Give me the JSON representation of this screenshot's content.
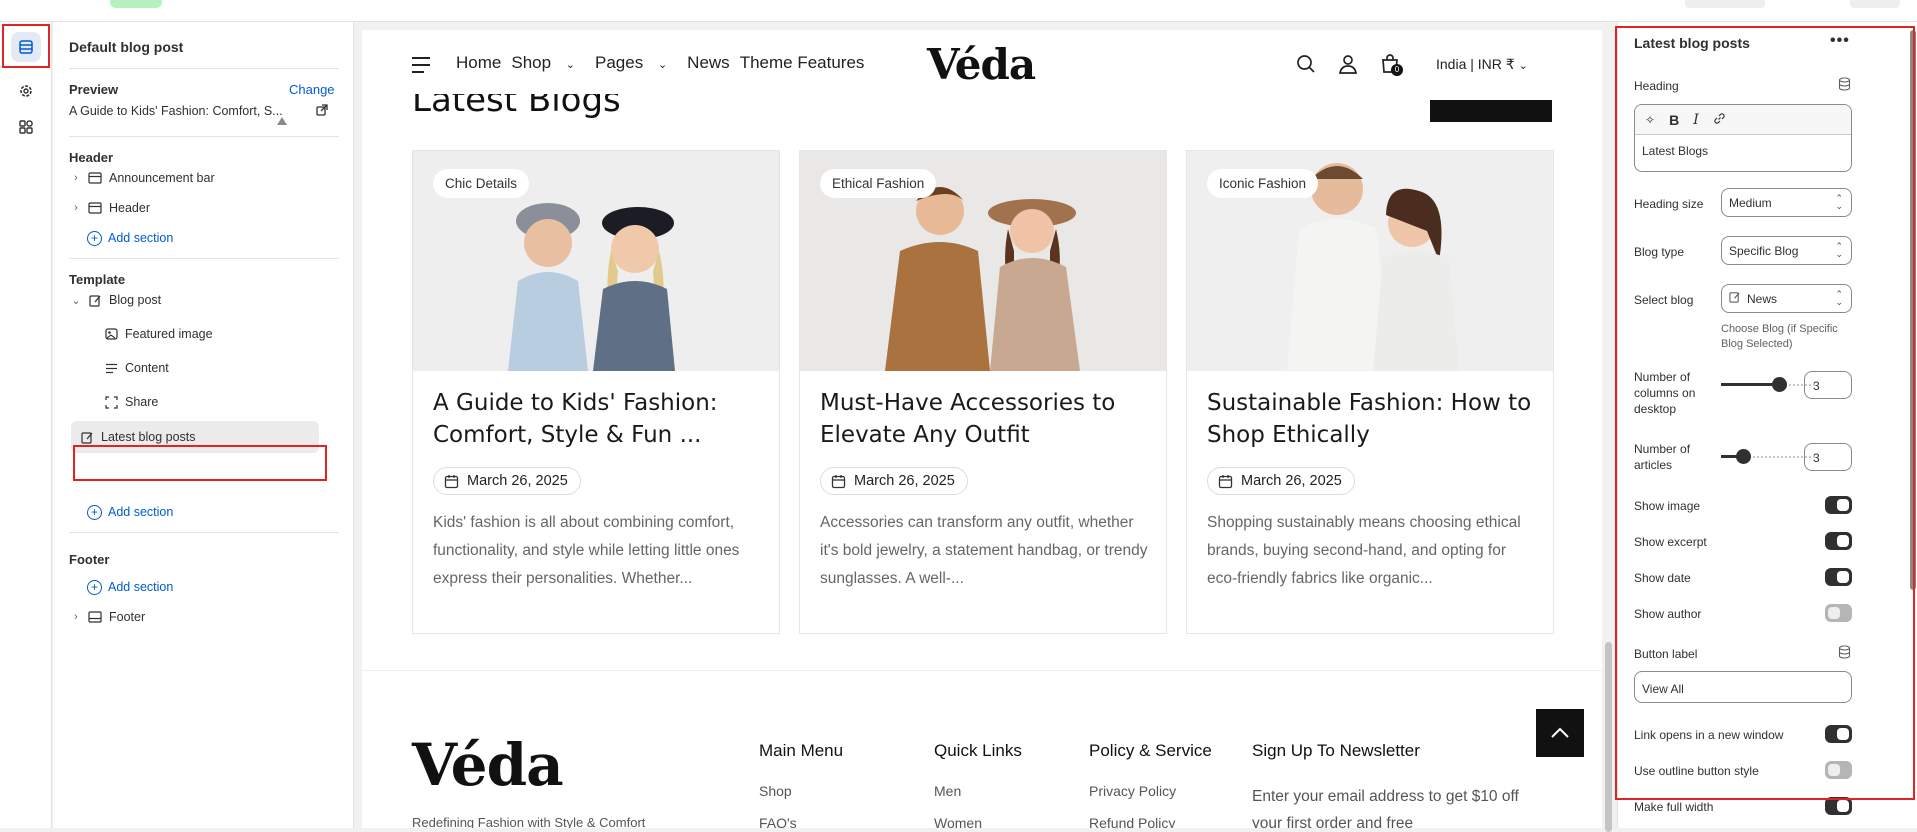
{
  "left_panel": {
    "title": "Default blog post",
    "preview_label": "Preview",
    "change_label": "Change",
    "preview_value": "A Guide to Kids' Fashion: Comfort, S...",
    "header_group": "Header",
    "header_items": [
      "Announcement bar",
      "Header"
    ],
    "add_section": "Add section",
    "template_group": "Template",
    "blog_post": "Blog post",
    "blog_blocks": [
      "Featured image",
      "Content",
      "Share"
    ],
    "latest_blog_posts": "Latest blog posts",
    "footer_group": "Footer",
    "footer_item": "Footer"
  },
  "store": {
    "nav_links": [
      "Home",
      "Shop",
      "Pages",
      "News",
      "Theme Features"
    ],
    "logo": "Véda",
    "cart_count": "0",
    "currency": "India | INR ₹",
    "section_heading": "Latest Blogs",
    "cards": [
      {
        "tag": "Chic Details",
        "title": "A Guide to Kids' Fashion: Comfort, Style & Fun ...",
        "date": "March 26, 2025",
        "excerpt": "Kids' fashion is all about combining comfort, functionality, and style while letting little ones express their personalities. Whether..."
      },
      {
        "tag": "Ethical Fashion",
        "title": "Must-Have Accessories to Elevate Any Outfit",
        "date": "March 26, 2025",
        "excerpt": "Accessories can transform any outfit, whether it's bold jewelry, a statement handbag, or trendy sunglasses. A well-..."
      },
      {
        "tag": "Iconic Fashion",
        "title": "Sustainable Fashion: How to Shop Ethically",
        "date": "March 26, 2025",
        "excerpt": "Shopping sustainably means choosing ethical brands, buying second-hand, and opting for eco-friendly fabrics like organic..."
      }
    ],
    "footer": {
      "logo": "Véda",
      "col1_title": "Main Menu",
      "col1_items": [
        "Shop",
        "FAQ's"
      ],
      "col2_title": "Quick Links",
      "col2_items": [
        "Men",
        "Women"
      ],
      "col3_title": "Policy & Service",
      "col3_items": [
        "Privacy Policy",
        "Refund Policy"
      ],
      "col4_title": "Sign Up To Newsletter",
      "col4_text": "Enter your email address to get $10 off your first order and free",
      "tagline_cut": "Redefining Fashion with Style & Comfort"
    }
  },
  "right_panel": {
    "title": "Latest blog posts",
    "more": "•••",
    "heading_label": "Heading",
    "heading_value": "Latest Blogs",
    "heading_size_label": "Heading size",
    "heading_size_value": "Medium",
    "blog_type_label": "Blog type",
    "blog_type_value": "Specific Blog",
    "select_blog_label": "Select blog",
    "select_blog_value": "News",
    "select_blog_help": "Choose Blog (if Specific Blog Selected)",
    "columns_label": "Number of columns on desktop",
    "columns_value": "3",
    "articles_label": "Number of articles",
    "articles_value": "3",
    "show_image": "Show image",
    "show_excerpt": "Show excerpt",
    "show_date": "Show date",
    "show_author": "Show author",
    "button_label_label": "Button label",
    "button_label_value": "View All",
    "new_window": "Link opens in a new window",
    "outline_style": "Use outline button style",
    "full_width": "Make full width",
    "toggles": {
      "show_image": true,
      "show_excerpt": true,
      "show_date": true,
      "show_author": false,
      "new_window": true,
      "outline_style": false,
      "full_width": true
    }
  },
  "colors": {
    "accent": "#005bd3",
    "highlight": "#e02424",
    "toggle_on": "#303030"
  }
}
